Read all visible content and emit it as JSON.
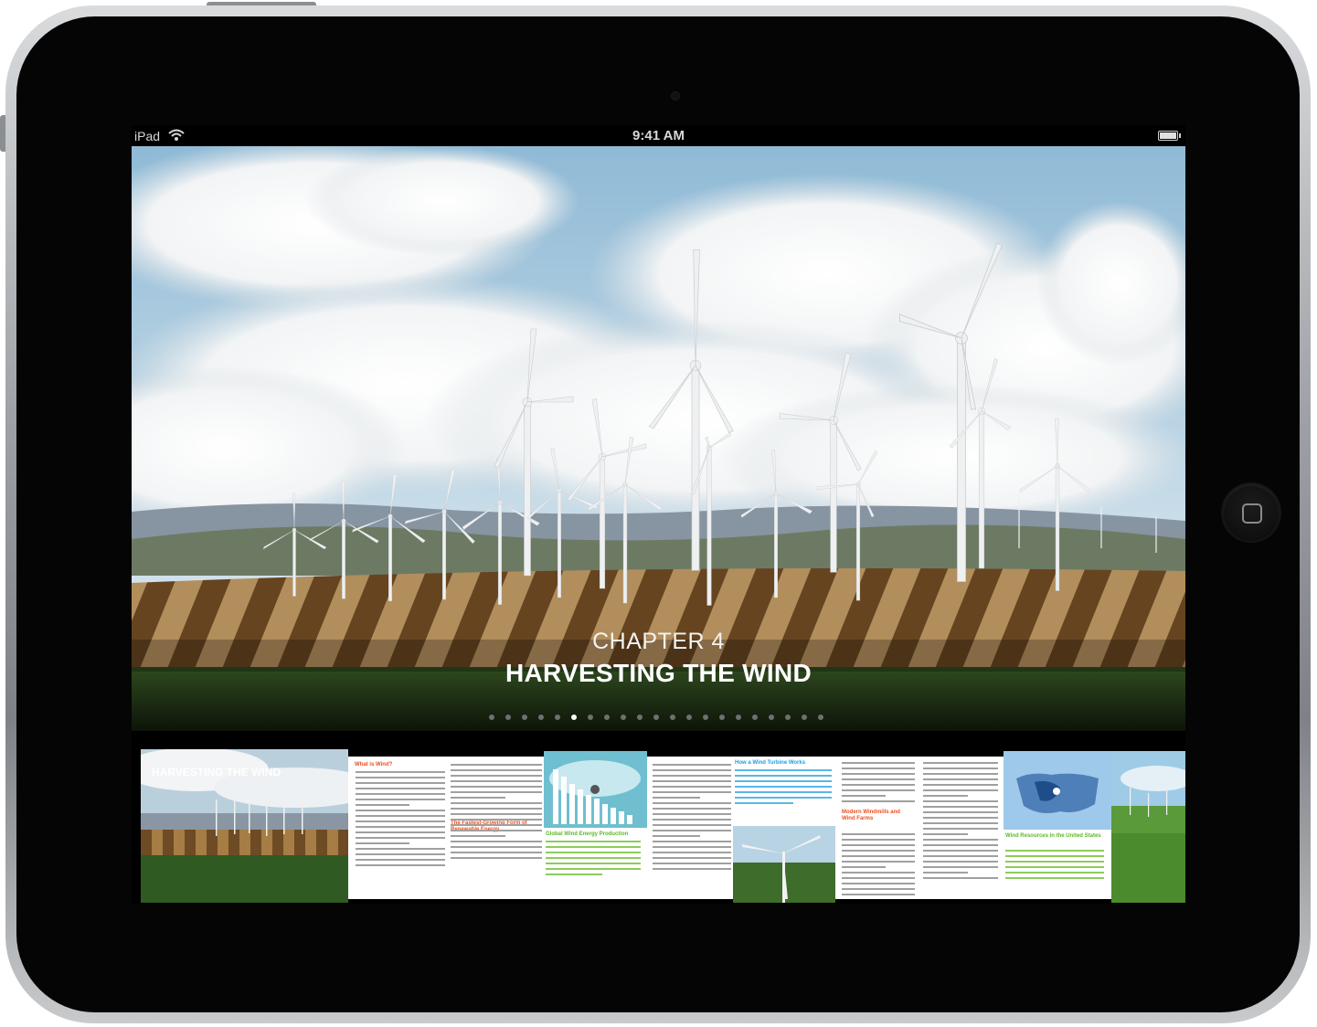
{
  "status_bar": {
    "device": "iPad",
    "time": "9:41 AM"
  },
  "chapter": {
    "label": "CHAPTER 4",
    "title": "HARVESTING THE WIND"
  },
  "pager": {
    "count": 21,
    "active_index": 5
  },
  "thumbnails": {
    "cover_title": "HARVESTING THE WIND",
    "p1_heading": "What is Wind?",
    "p2_heading": "The Fastest-Growing Form of Renewable Energy",
    "p3_heading": "Global Wind Energy Production",
    "p4_heading": "How a Wind Turbine Works",
    "p5_heading": "Modern Windmills and Wind Farms",
    "p6_heading": "Wind Resources in the United States"
  },
  "colors": {
    "heading_orange": "#e8501e",
    "heading_cyan": "#1aa0e0",
    "heading_green": "#5cb829"
  }
}
